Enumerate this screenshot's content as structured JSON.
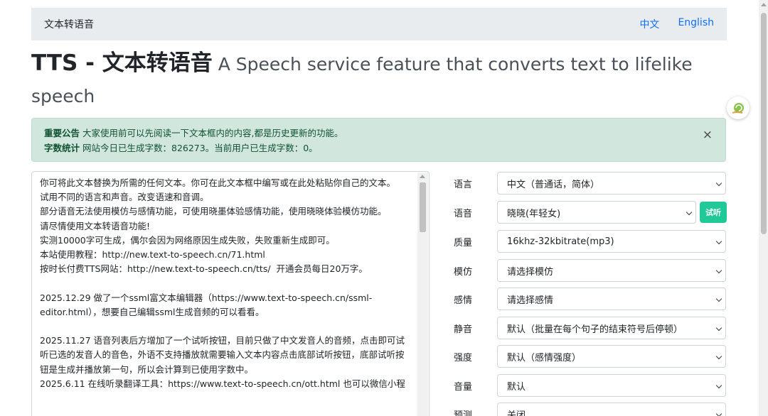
{
  "navbar": {
    "brand": "文本转语音",
    "links": [
      "中文",
      "English"
    ]
  },
  "heading": {
    "main": "TTS - 文本转语音",
    "sub": " A Speech service feature that converts text to lifelike speech"
  },
  "alert": {
    "line1_label": "重要公告",
    "line1_text": " 大家使用前可以先阅读一下文本框内的内容,都是历史更新的功能。",
    "line2_label": "字数统计",
    "line2_text": " 网站今日已生成字数：826273。当前用户已生成字数：0。",
    "close": "×"
  },
  "textbox": {
    "paragraphs": [
      "你可将此文本替换为所需的任何文本。你可在此文本框中编写或在此处粘贴你自己的文本。",
      "试用不同的语言和声音。改变语速和音调。",
      "部分语音无法使用模仿与感情功能，可使用晓墨体验感情功能，使用晓晓体验模仿功能。",
      "请尽情使用文本转语音功能!",
      "实测10000字可生成，偶尔会因为网络原因生成失败，失败重新生成即可。",
      "本站使用教程：http://new.text-to-speech.cn/71.html",
      "按时长付费TTS网站：http://new.text-to-speech.cn/tts/  开通会员每日20万字。",
      "",
      "2025.12.29 做了一个ssml富文本编辑器（https://www.text-to-speech.cn/ssml-editor.html），想要自己编辑ssml生成音频的可以看看。",
      "",
      "2025.11.27 语音列表后方增加了一个试听按钮，目前只做了中文发音人的音频，点击即可试听已选的发音人的音色，外语不支持播放就需要输入文本内容点击底部试听按钮，底部试听按钮是生成并播放第一句，所以会计算到已使用字数中。",
      "2025.6.11 在线听录翻译工具：https://www.text-to-speech.cn/ott.html 也可以微信小程"
    ]
  },
  "form": {
    "rows": [
      {
        "label": "语言",
        "value": "中文（普通话，简体）"
      },
      {
        "label": "语音",
        "value": "晓晓(年轻女)",
        "button": "试听"
      },
      {
        "label": "质量",
        "value": "16khz-32kbitrate(mp3)"
      },
      {
        "label": "模仿",
        "value": "请选择模仿"
      },
      {
        "label": "感情",
        "value": "请选择感情"
      },
      {
        "label": "静音",
        "value": "默认（批量在每个句子的结束符号后停顿）"
      },
      {
        "label": "强度",
        "value": "默认（感情强度）"
      },
      {
        "label": "音量",
        "value": "默认"
      },
      {
        "label": "预测",
        "value": "关闭"
      }
    ]
  },
  "colors": {
    "accent": "#0d6efd",
    "alert_bg": "#d1e7dd",
    "alert_text": "#0f5132",
    "listen_button": "#20c997"
  }
}
